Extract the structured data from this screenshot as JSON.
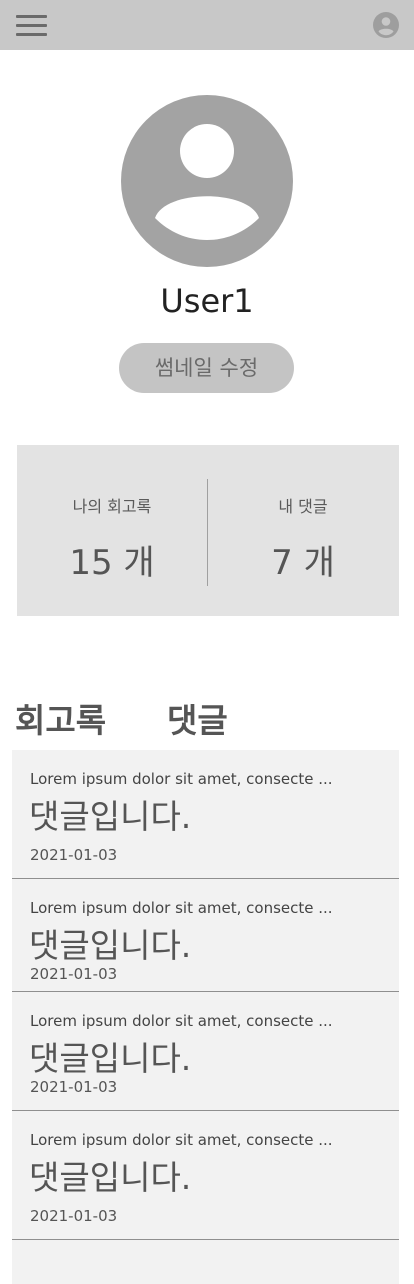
{
  "header": {
    "menu_icon": "hamburger-menu-icon",
    "account_icon": "account-circle-icon"
  },
  "profile": {
    "avatar_icon": "user-avatar-icon",
    "username": "User1",
    "edit_thumbnail_label": "썸네일 수정"
  },
  "stats": {
    "left": {
      "label": "나의 회고록",
      "value": "15 개"
    },
    "right": {
      "label": "내 댓글",
      "value": "7 개"
    }
  },
  "tabs": [
    {
      "label": "회고록"
    },
    {
      "label": "댓글"
    }
  ],
  "comments": [
    {
      "title": "Lorem ipsum dolor sit amet, consecte ...",
      "comment": "댓글입니다.",
      "date": "2021-01-03"
    },
    {
      "title": "Lorem ipsum dolor sit amet, consecte ...",
      "comment": "댓글입니다.",
      "date": "2021-01-03"
    },
    {
      "title": "Lorem ipsum dolor sit amet, consecte ...",
      "comment": "댓글입니다.",
      "date": "2021-01-03"
    },
    {
      "title": "Lorem ipsum dolor sit amet, consecte ...",
      "comment": "댓글입니다.",
      "date": "2021-01-03"
    }
  ],
  "colors": {
    "header_bg": "#c8c8c8",
    "icon_gray": "#a0a0a0",
    "panel_bg": "#e3e3e3",
    "list_bg": "#f2f2f2"
  }
}
